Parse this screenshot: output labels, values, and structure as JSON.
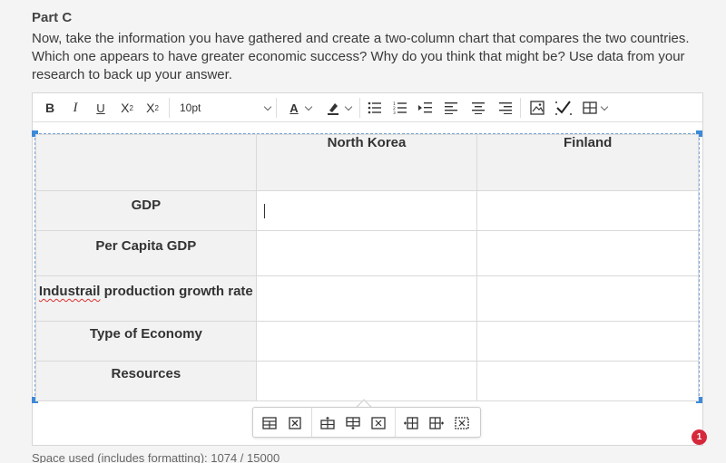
{
  "part_title": "Part C",
  "prompt": "Now, take the information you have gathered and create a two-column chart that compares the two countries. Which one appears to have greater economic success? Why do you think that might be? Use data from your research to back up your answer.",
  "toolbar": {
    "bold_icon": "bold-icon",
    "italic_icon": "italic-icon",
    "underline_icon": "underline-icon",
    "superscript_icon": "superscript-icon",
    "subscript_icon": "subscript-icon",
    "font_size": "10pt",
    "font_color_icon": "font-color-icon",
    "highlight_icon": "highlight-icon",
    "bullet_list_icon": "bullet-list-icon",
    "numbered_list_icon": "numbered-list-icon",
    "indent_icon": "indent-icon",
    "align_left_icon": "align-left-icon",
    "align_center_icon": "align-center-icon",
    "align_right_icon": "align-right-icon",
    "image_icon": "image-icon",
    "spellcheck_icon": "spellcheck-icon",
    "table_icon": "table-icon"
  },
  "table": {
    "headers": [
      "",
      "North Korea",
      "Finland"
    ],
    "rows": [
      {
        "label": "GDP",
        "north_korea": "",
        "finland": ""
      },
      {
        "label": "Per Capita GDP",
        "north_korea": "",
        "finland": ""
      },
      {
        "label_misspelled": "Industrail",
        "label_rest": " production growth rate",
        "north_korea": "",
        "finland": ""
      },
      {
        "label": "Type of Economy",
        "north_korea": "",
        "finland": ""
      },
      {
        "label": "Resources",
        "north_korea": "",
        "finland": ""
      }
    ]
  },
  "notification_count": "1",
  "space_used": "Space used (includes formatting): 1074 / 15000"
}
